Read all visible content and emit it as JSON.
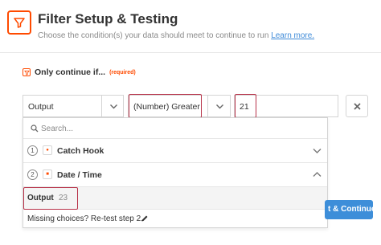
{
  "header": {
    "title": "Filter Setup & Testing",
    "subtitle": "Choose the condition(s) your data should meet to continue to run",
    "learn_more": "Learn more."
  },
  "condition": {
    "label": "Only continue if...",
    "required": "(required)",
    "field": "Output",
    "operator": "(Number) Greater",
    "value": "21"
  },
  "dropdown": {
    "search_placeholder": "Search...",
    "steps": [
      {
        "number": "1",
        "app_icon": "webhook-icon",
        "label": "Catch Hook",
        "state": "collapsed"
      },
      {
        "number": "2",
        "app_icon": "formatter-icon",
        "label": "Date / Time",
        "state": "expanded"
      }
    ],
    "option": {
      "label": "Output",
      "value": "23"
    },
    "missing_text": "Missing choices? Re-test step 2."
  },
  "continue_button": "t & Continue",
  "colors": {
    "brand_orange": "#ff4a00",
    "highlight": "#b8334a",
    "button_blue": "#3d8ed9",
    "link_blue": "#3f8bd8"
  }
}
